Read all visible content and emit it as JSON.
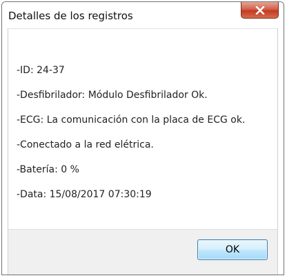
{
  "window": {
    "title": "Detalles de los registros",
    "close_icon": "close-x-icon"
  },
  "details": {
    "lines": [
      "-ID: 24-37",
      "-Desfibrilador: Módulo Desfibrilador Ok.",
      "-ECG: La comunicación con la placa de ECG ok.",
      "-Conectado a la red elétrica.",
      "-Batería: 0 %",
      "-Data: 15/08/2017 07:30:19"
    ]
  },
  "buttons": {
    "ok_label": "OK"
  },
  "colors": {
    "close_button": "#c8452c",
    "ok_border": "#3c7fb1"
  }
}
